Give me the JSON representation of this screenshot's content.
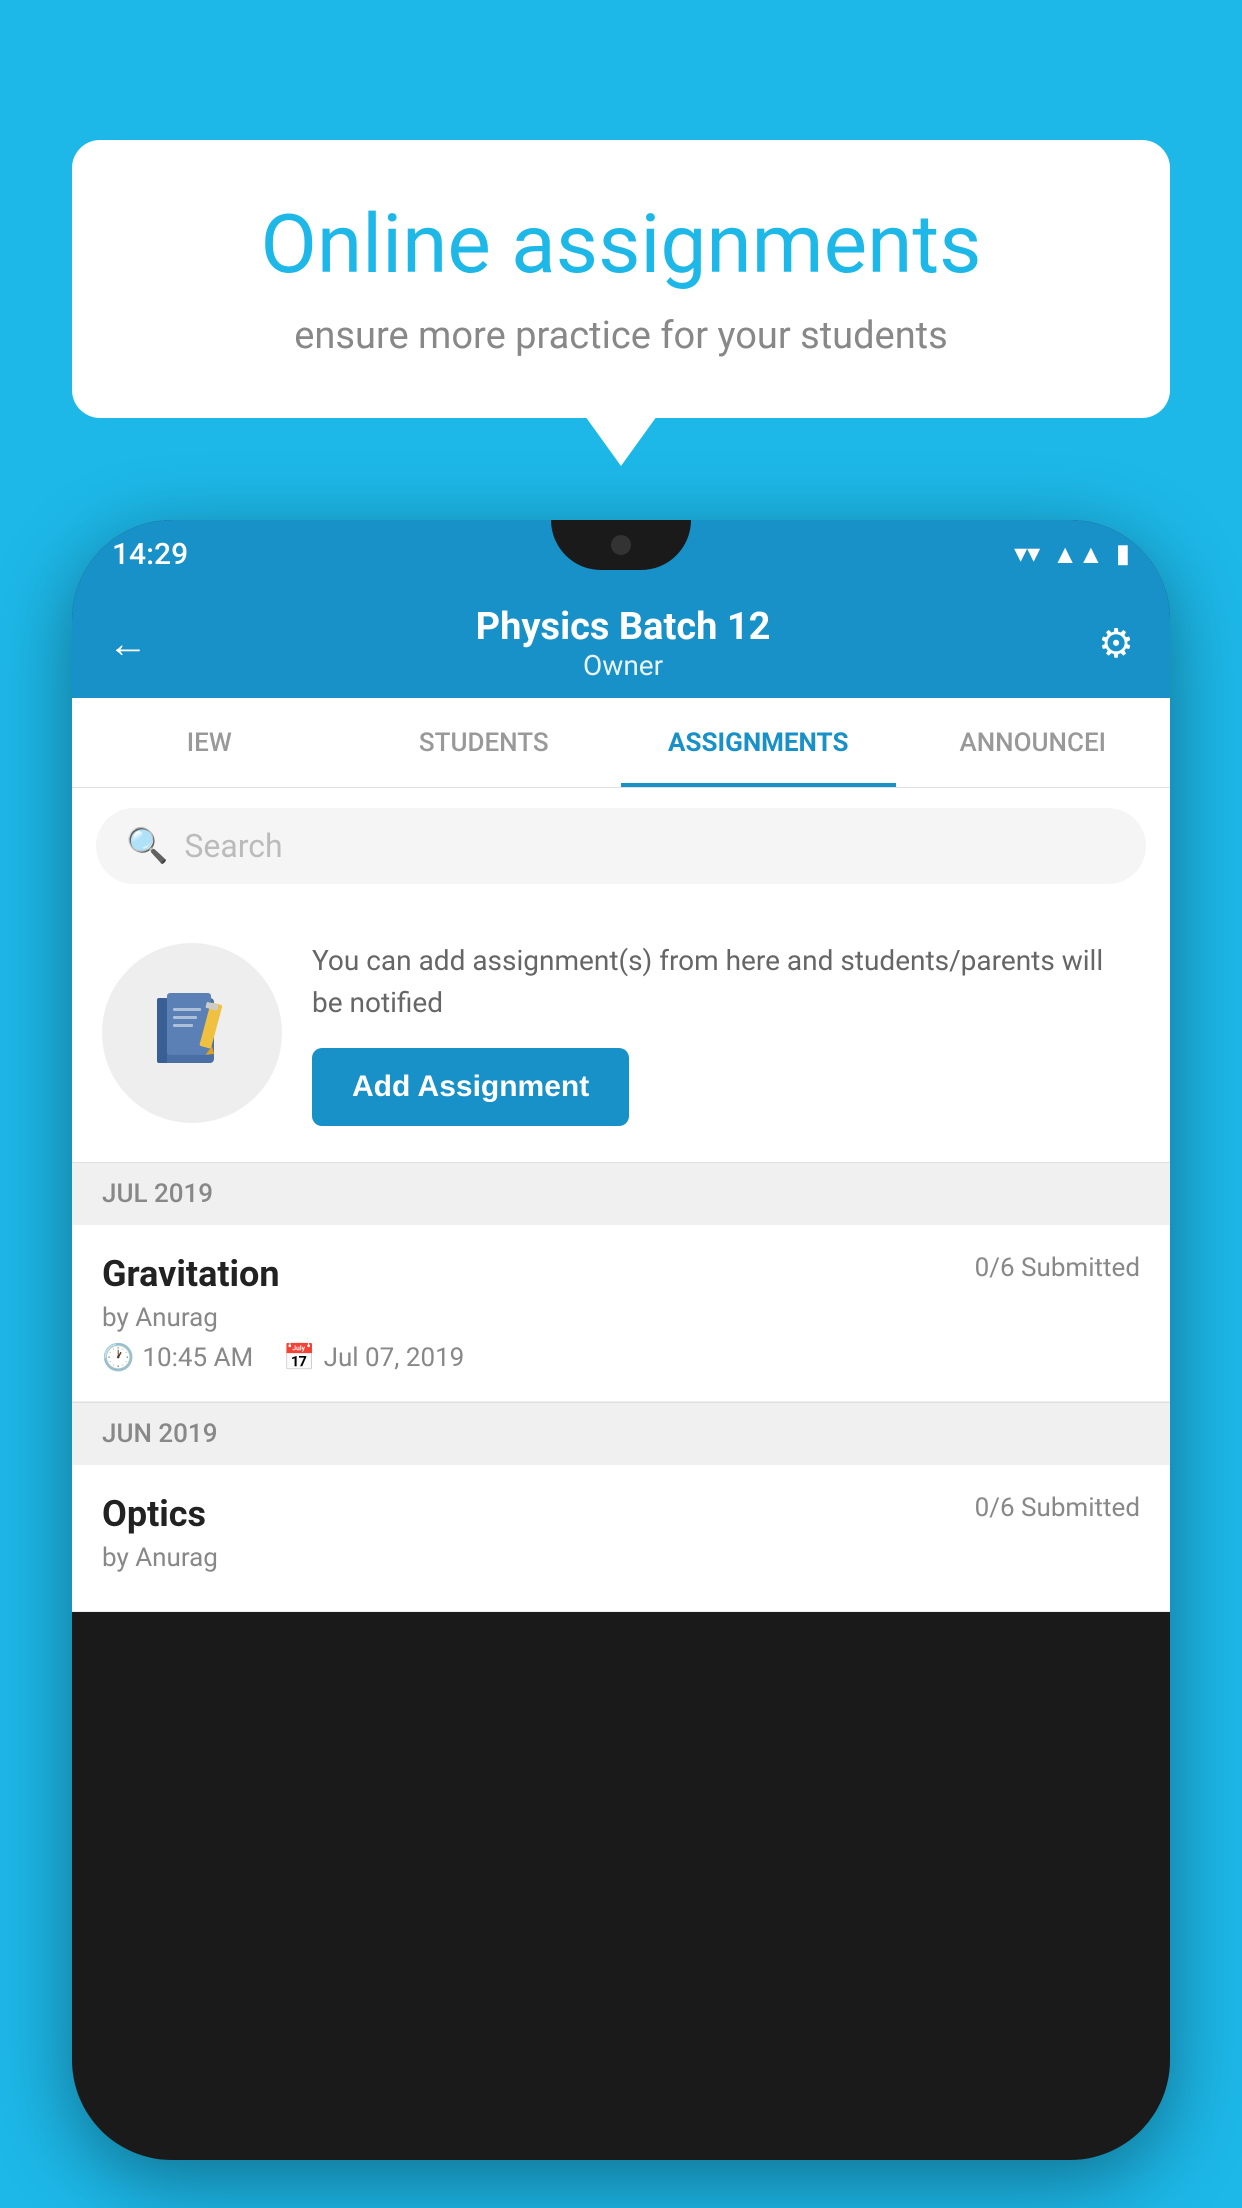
{
  "background_color": "#1db8e8",
  "speech_bubble": {
    "title": "Online assignments",
    "subtitle": "ensure more practice for your students"
  },
  "phone": {
    "status_bar": {
      "time": "14:29"
    },
    "header": {
      "title": "Physics Batch 12",
      "subtitle": "Owner",
      "back_label": "←",
      "settings_label": "⚙"
    },
    "tabs": [
      {
        "label": "IEW",
        "active": false
      },
      {
        "label": "STUDENTS",
        "active": false
      },
      {
        "label": "ASSIGNMENTS",
        "active": true
      },
      {
        "label": "ANNOUNCEI",
        "active": false
      }
    ],
    "search": {
      "placeholder": "Search"
    },
    "empty_state": {
      "description": "You can add assignment(s) from here and students/parents will be notified",
      "button_label": "Add Assignment"
    },
    "sections": [
      {
        "label": "JUL 2019",
        "assignments": [
          {
            "name": "Gravitation",
            "submitted": "0/6 Submitted",
            "by": "by Anurag",
            "time": "10:45 AM",
            "date": "Jul 07, 2019"
          }
        ]
      },
      {
        "label": "JUN 2019",
        "assignments": [
          {
            "name": "Optics",
            "submitted": "0/6 Submitted",
            "by": "by Anurag",
            "time": "",
            "date": ""
          }
        ]
      }
    ]
  }
}
